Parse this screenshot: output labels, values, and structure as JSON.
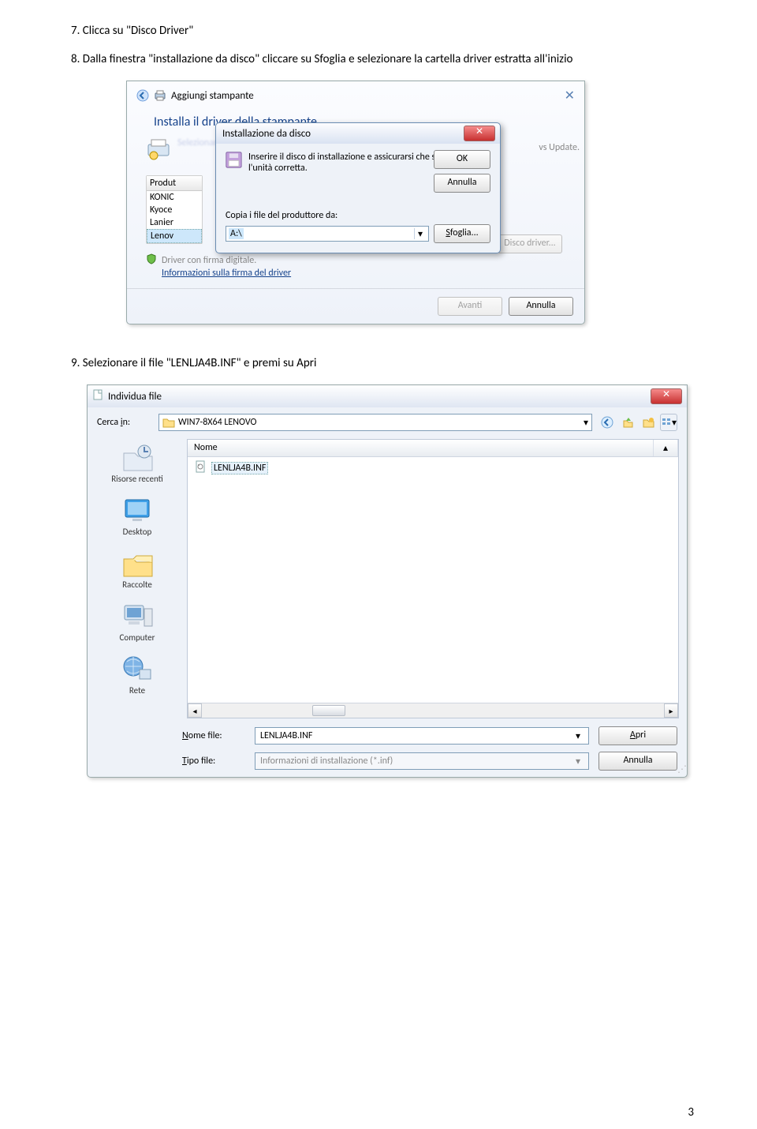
{
  "doc": {
    "step7": "7. Clicca su \"Disco Driver\"",
    "step8": "8. Dalla finestra \"installazione da disco\" cliccare su Sfoglia e selezionare la cartella driver estratta all'inizio",
    "step9": "9. Selezionare il file \"LENLJA4B.INF\" e premi su Apri",
    "pagenum": "3"
  },
  "sc1": {
    "back_title": "Aggiungi stampante",
    "subhead": "Installa il driver della stampante",
    "upd_hint": "vs Update.",
    "list_header": "Produt",
    "list_items": [
      "KONIC",
      "Kyoce",
      "Lanier",
      "Lenov"
    ],
    "signed": "Driver con firma digitale.",
    "signed_link": "Informazioni sulla firma del driver",
    "btn_update": "Windows Update",
    "btn_disk": "Disco driver...",
    "btn_next": "Avanti",
    "btn_cancel": "Annulla"
  },
  "ovl": {
    "title": "Installazione da disco",
    "msg": "Inserire il disco di installazione e assicurarsi che sia selezionata l'unità corretta.",
    "ok": "OK",
    "cancel": "Annulla",
    "copy_label": "Copia i file del produttore da:",
    "path": "A:\\",
    "browse": "Sfoglia..."
  },
  "sc2": {
    "title": "Individua file",
    "look_in": "Cerca in:",
    "folder": "WIN7-8X64 LENOVO",
    "col_name": "Nome",
    "file": "LENLJA4B.INF",
    "side": {
      "recent": "Risorse recenti",
      "desktop": "Desktop",
      "libs": "Raccolte",
      "computer": "Computer",
      "net": "Rete"
    },
    "name_lbl": "Nome file:",
    "name_val": "LENLJA4B.INF",
    "type_lbl": "Tipo file:",
    "type_val": "Informazioni di installazione (*.inf)",
    "open": "Apri",
    "cancel": "Annulla"
  }
}
